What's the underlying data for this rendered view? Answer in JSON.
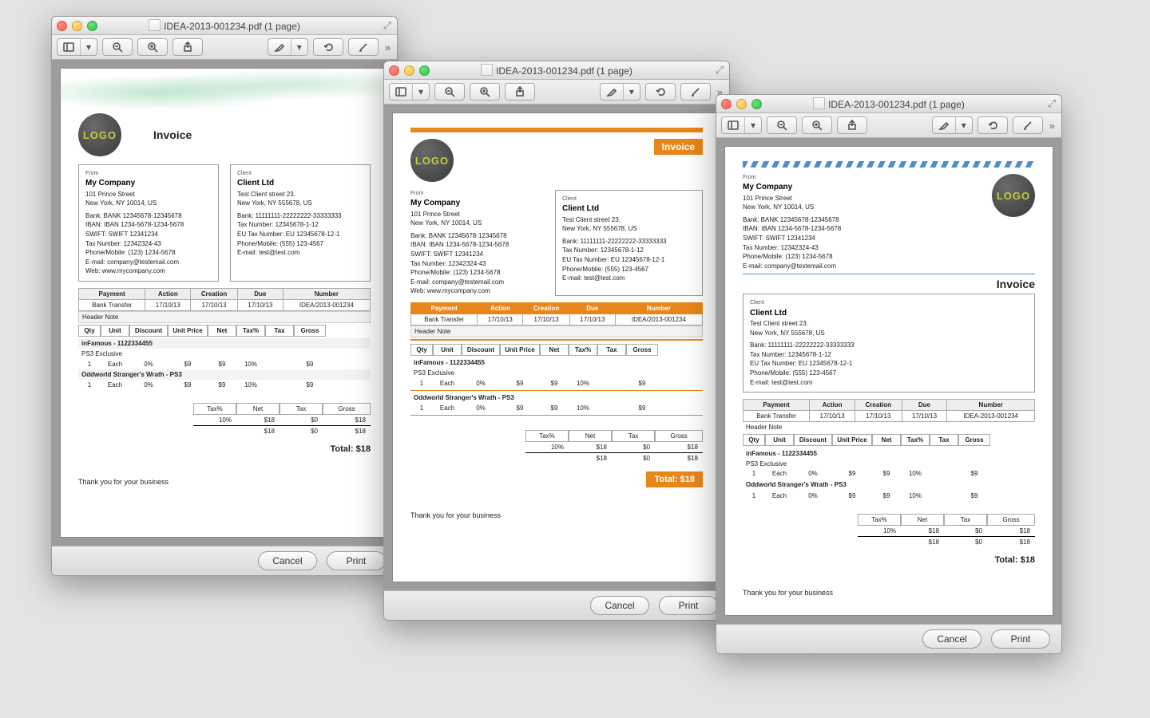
{
  "btn": {
    "cancel": "Cancel",
    "print": "Print"
  },
  "company": {
    "label": "From",
    "name": "My Company",
    "addr1": "101 Prince Street",
    "addr2": "New York, NY 10014, US",
    "bank": "Bank: BANK 12345678-12345678",
    "iban": "IBAN: IBAN 1234-5678-1234-5678",
    "swift": "SWIFT: SWIFT 12341234",
    "taxno": "Tax Number: 12342324-43",
    "phone": "Phone/Mobile: (123) 1234-5678",
    "email": "E-mail: company@testemail.com",
    "web": "Web: www.mycompany.com"
  },
  "client": {
    "label": "Client",
    "name": "Client Ltd",
    "addr1": "Test Client street 23.",
    "addr2": "New York, NY 555678, US",
    "bank": "Bank: 11111111-22222222-33333333",
    "taxno": "Tax Number: 12345678-1-12",
    "eutax": "EU Tax Number: EU 12345678-12-1",
    "phone": "Phone/Mobile: (555) 123-4567",
    "email": "E-mail: test@test.com"
  },
  "phead": {
    "payment": "Payment",
    "action": "Action",
    "creation": "Creation",
    "due": "Due",
    "number": "Number"
  },
  "prow": {
    "payment": "Bank Transfer",
    "action": "17/10/13",
    "creation": "17/10/13",
    "due": "17/10/13",
    "number": "IDEA/2013-001234",
    "number_blue": "IDEA-2013-001234"
  },
  "note": "Header Note",
  "cols": {
    "qty": "Qty",
    "unit": "Unit",
    "discount": "Discount",
    "uprice": "Unit Price",
    "net": "Net",
    "taxp": "Tax%",
    "tax": "Tax",
    "gross": "Gross"
  },
  "items_title": "inFamous - 1122334455",
  "item1": {
    "name": "PS3 Exclusive",
    "qty": "1",
    "unit": "Each",
    "disc": "0%",
    "uprice": "$9",
    "net": "$9",
    "taxp": "10%",
    "tax": "",
    "gross": "$9"
  },
  "item2": {
    "name": "Oddworld Stranger's Wrath - PS3",
    "qty": "1",
    "unit": "Each",
    "disc": "0%",
    "uprice": "$9",
    "net": "$9",
    "taxp": "10%",
    "tax": "",
    "gross": "$9"
  },
  "sum": {
    "taxp": "Tax%",
    "net": "Net",
    "tax": "Tax",
    "gross": "Gross",
    "taxp_v": "10%",
    "net_v": "$18",
    "tax_v": "$0",
    "gross_v": "$18",
    "net2": "$18",
    "tax2": "$0",
    "gross2": "$18"
  },
  "total": "Total: $18",
  "thanks": "Thank you for your business",
  "invoice_label": "Invoice",
  "logo": "LOGO",
  "win": {
    "title": "IDEA-2013-001234.pdf (1 page)"
  }
}
